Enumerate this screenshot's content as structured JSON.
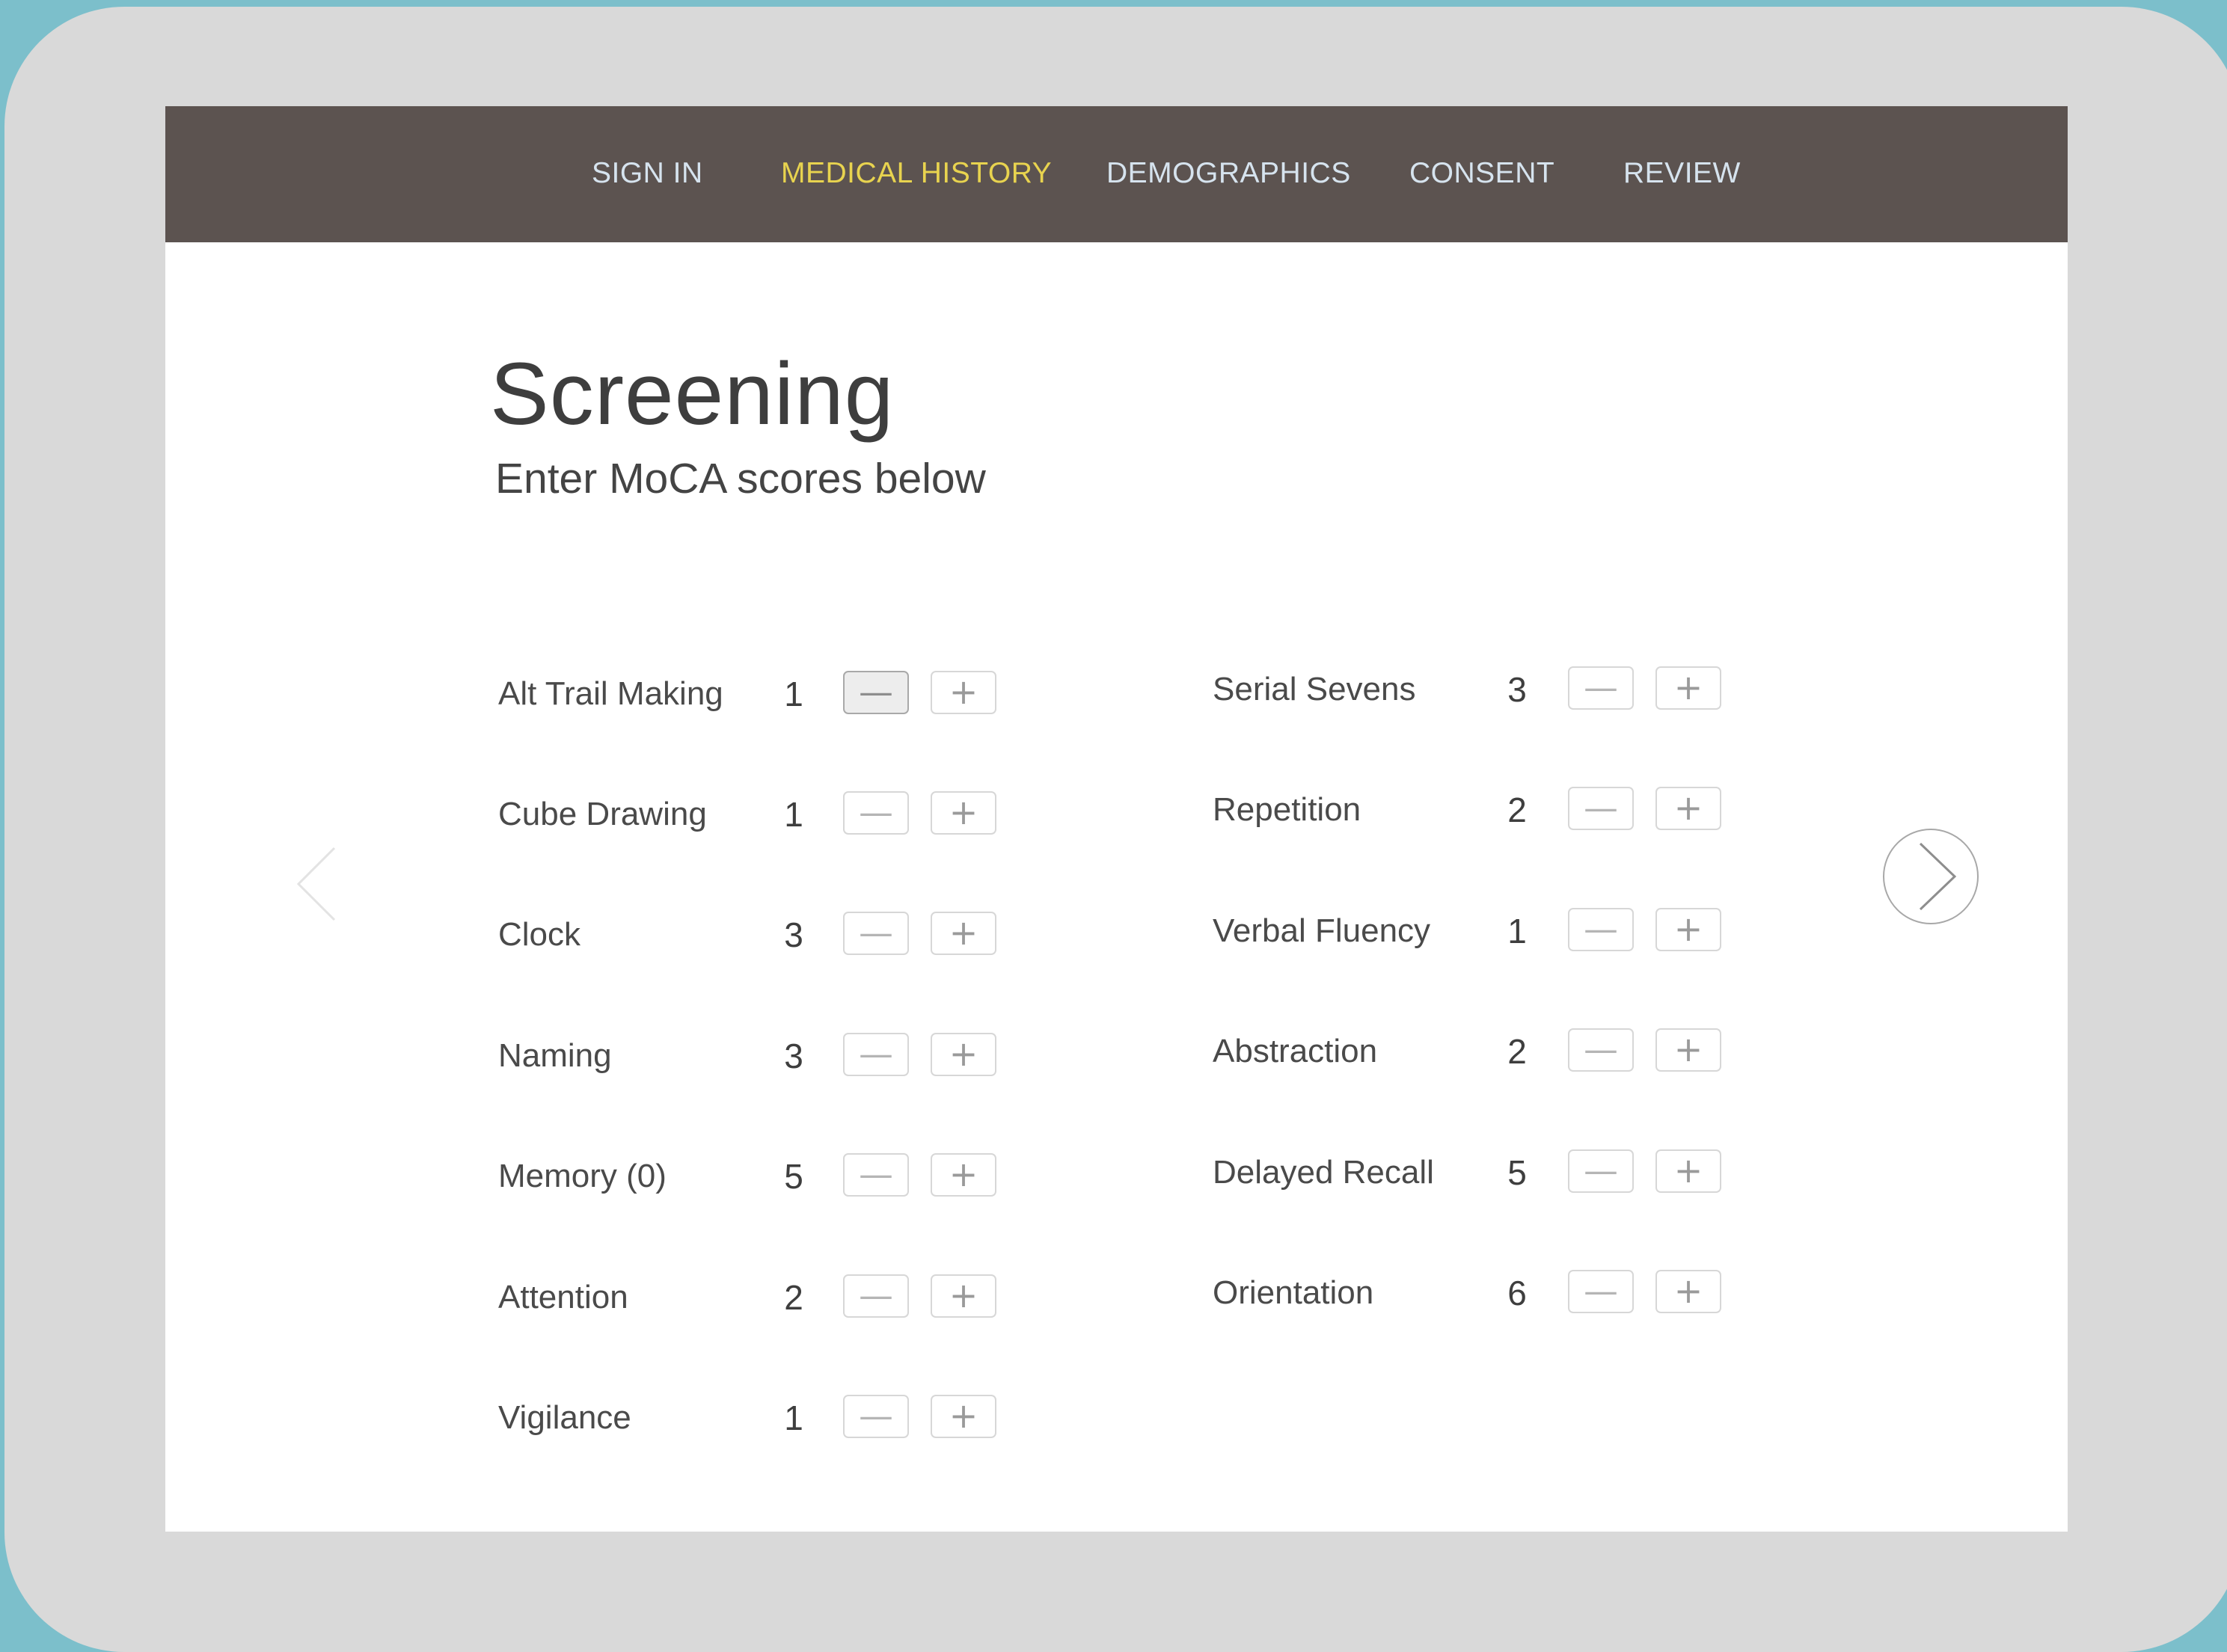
{
  "nav": {
    "items": [
      {
        "label": "SIGN IN",
        "active": false
      },
      {
        "label": "MEDICAL HISTORY",
        "active": true
      },
      {
        "label": "DEMOGRAPHICS",
        "active": false
      },
      {
        "label": "CONSENT",
        "active": false
      },
      {
        "label": "REVIEW",
        "active": false
      }
    ]
  },
  "page": {
    "title": "Screening",
    "subtitle": "Enter MoCA scores below"
  },
  "stepper": {
    "minus_symbol": "—",
    "plus_symbol": "+"
  },
  "scores": {
    "left": [
      {
        "label": "Alt Trail Making",
        "value": "1"
      },
      {
        "label": "Cube Drawing",
        "value": "1"
      },
      {
        "label": "Clock",
        "value": "3"
      },
      {
        "label": "Naming",
        "value": "3"
      },
      {
        "label": "Memory (0)",
        "value": "5"
      },
      {
        "label": "Attention",
        "value": "2"
      },
      {
        "label": "Vigilance",
        "value": "1"
      }
    ],
    "right": [
      {
        "label": "Serial Sevens",
        "value": "3"
      },
      {
        "label": "Repetition",
        "value": "2"
      },
      {
        "label": "Verbal Fluency",
        "value": "1"
      },
      {
        "label": "Abstraction",
        "value": "2"
      },
      {
        "label": "Delayed Recall",
        "value": "5"
      },
      {
        "label": "Orientation",
        "value": "6"
      }
    ]
  },
  "navigation": {
    "prev_icon": "chevron-left-icon",
    "next_icon": "chevron-right-icon"
  },
  "colors": {
    "navbar": "#5c5350",
    "nav_text": "#d6e3ee",
    "nav_active": "#e8d34f",
    "bezel": "#d9d9d9",
    "frame": "#7cbfcb"
  }
}
